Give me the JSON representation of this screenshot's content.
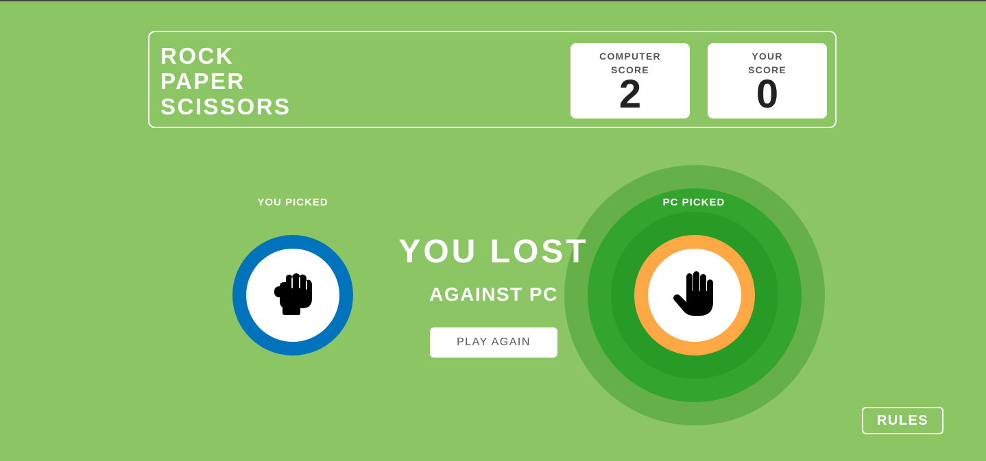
{
  "header": {
    "title_lines": [
      "ROCK",
      "PAPER",
      "SCISSORS"
    ],
    "computer_score": {
      "label_lines": [
        "COMPUTER",
        "SCORE"
      ],
      "value": "2"
    },
    "your_score": {
      "label_lines": [
        "YOUR",
        "SCORE"
      ],
      "value": "0"
    }
  },
  "picks": {
    "you_label": "YOU PICKED",
    "you_choice_icon": "rock-fist-icon",
    "pc_label": "PC PICKED",
    "pc_choice_icon": "paper-hand-icon"
  },
  "result": {
    "title": "YOU LOST",
    "subtitle": "AGAINST PC",
    "play_again_label": "PLAY AGAIN"
  },
  "rules_label": "RULES",
  "colors": {
    "background": "#8cc563",
    "rock_ring": "#0073bc",
    "paper_ring": "#ffa845",
    "winner_glow_outer": "#65b048",
    "winner_glow_middle": "#33a52e",
    "winner_glow_inner": "#289b27"
  }
}
